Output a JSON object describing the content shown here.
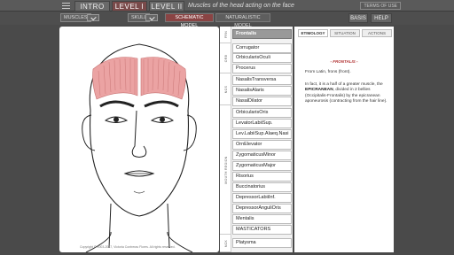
{
  "toolbar": {
    "tabs": [
      {
        "label": "INTRO"
      },
      {
        "label": "LEVEL I"
      },
      {
        "label": "LEVEL II"
      }
    ],
    "title": "Muscles of the head acting on the face",
    "terms": "TERMS OF USE"
  },
  "subbar": {
    "muscles": "MUSCLES",
    "skull": "SKULL",
    "schematic": "SCHEMATIC MODEL",
    "naturalistic": "NATURALISTIC MODEL",
    "basis": "BASIS",
    "help": "HELP"
  },
  "face": {
    "copyright": "Copyright © 2003-2017, Victoria Contreras Flores. All rights reserved."
  },
  "groups": [
    "FRN",
    "ORB",
    "NOS",
    "MOUTH REGION",
    "NCK"
  ],
  "muscles": [
    "Frontalis",
    "Corrugator",
    "OrbicularisOculi",
    "Procerus",
    "NasalisTransversa",
    "NasalisAlaris",
    "NasalDilator",
    "OrbicularisOris",
    "LevatorLabiiSup.",
    "Lev.LabiiSup.Alaeq.Nasi",
    "OrnElevator",
    "ZygomaticusMinor",
    "ZygomaticusMajor",
    "Risorius",
    "Buccinatorius",
    "DepressorLabiiInf.",
    "DepressorAnguliOris",
    "Mentalis",
    "MASTICATORS",
    "Platysma"
  ],
  "info": {
    "tabs": [
      "ETIMOLOGY",
      "SITUATION",
      "ACTIONS"
    ],
    "heading": "- FRONTALIS -",
    "p1": "From Latin, frons (front).",
    "p2_a": "In fact, it is a half of a greater muscle, the ",
    "p2_b": "EPICRANEAN",
    "p2_c": ", divided in 2 bellies (Occipitalis-Frontalis) by the epicranean aponeurosis (contracting from the hair line)."
  },
  "colors": {
    "active_tab": "#7a4a4a",
    "muscle_fill": "#e8a0a0",
    "heading": "#b03030"
  }
}
